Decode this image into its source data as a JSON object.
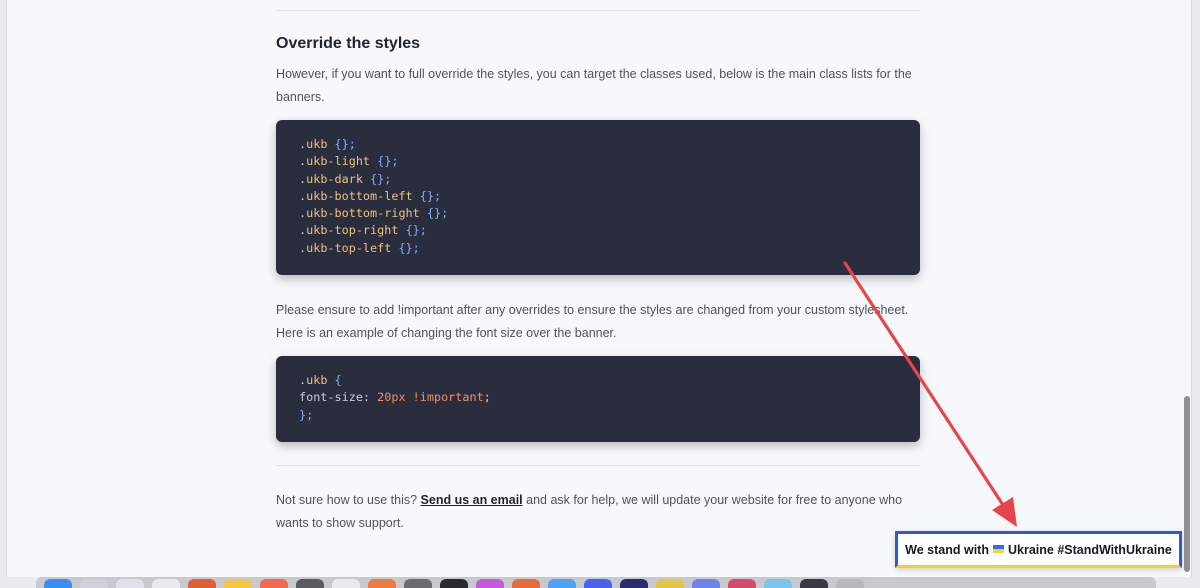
{
  "section": {
    "title": "Override the styles",
    "intro_text": "However, if you want to full override the styles, you can target the classes used, below is the main class lists for the banners."
  },
  "code_block_1": {
    "lines": [
      ".ukb {};",
      ".ukb-light {};",
      ".ukb-dark {};",
      ".ukb-bottom-left {};",
      ".ukb-bottom-right {};",
      ".ukb-top-right {};",
      ".ukb-top-left {};"
    ]
  },
  "important_note": "Please ensure to add !important after any overrides to ensure the styles are changed from your custom stylesheet. Here is an example of changing the font size over the banner.",
  "code_block_2": {
    "selector": ".ukb",
    "property": "font-size",
    "value": "20px",
    "important": "!important"
  },
  "support": {
    "text_before": "Not sure how to use this?",
    "link_label": "Send us an email",
    "text_after": "and ask for help, we will update your website for free to anyone who wants to show support."
  },
  "banner": {
    "text_before_flag": "We stand with",
    "text_after_flag": "Ukraine #StandWithUkraine",
    "flag_icon": "ukraine-flag-icon",
    "border_color_top": "#2e5bd0",
    "border_color_bottom": "#f5cf2e"
  },
  "annotation": {
    "arrow_color": "#e8454a"
  },
  "dock": {
    "icon_colors": [
      "#3a8ef0",
      "#cfd2da",
      "#dfe2ea",
      "#e9e9ef",
      "#e25d3a",
      "#f3c74a",
      "#f06a52",
      "#5a5a62",
      "#e9e9ef",
      "#e97c41",
      "#6b6b73",
      "#2a2a30",
      "#c45bd8",
      "#e46d3d",
      "#4fa3f1",
      "#4a60f0",
      "#2c2c6d",
      "#e0c54a",
      "#6a84e8",
      "#d64b6a",
      "#7bc4f0",
      "#3a3a44",
      "#b8b8c0",
      "#c9c9d0"
    ]
  }
}
